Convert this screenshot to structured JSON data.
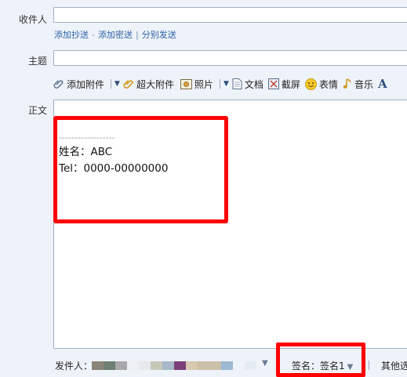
{
  "recipient": {
    "label": "收件人",
    "value": ""
  },
  "recipient_links": [
    {
      "label": "添加抄送"
    },
    {
      "label": "添加密送"
    },
    {
      "label": "分别发送"
    }
  ],
  "subject": {
    "label": "主题",
    "value": ""
  },
  "toolbar": {
    "attach": "添加附件",
    "big_attach": "超大附件",
    "photo": "照片",
    "doc": "文档",
    "screenshot": "截屏",
    "emoji": "表情",
    "music": "音乐"
  },
  "body": {
    "label": "正文",
    "dashes": "------------------",
    "name_line": "姓名：ABC",
    "tel_line": "Tel：0000-00000000"
  },
  "footer": {
    "sender_label": "发件人：",
    "signature_label": "签名：签名1",
    "other": "其他选"
  },
  "colors": {
    "highlight": "#ff0000",
    "link": "#2e62a8",
    "background": "#eef3f9"
  },
  "sender_blur_colors": [
    "#8b8478",
    "#6f7f72",
    "#a9a9a9",
    "#eef1f4",
    "#e6eaee",
    "#c6c8b8",
    "#a8b8c9",
    "#7a3f7a",
    "#d8c8b0",
    "#ccc0a8",
    "#9db9d3",
    "#e3ecf2"
  ]
}
